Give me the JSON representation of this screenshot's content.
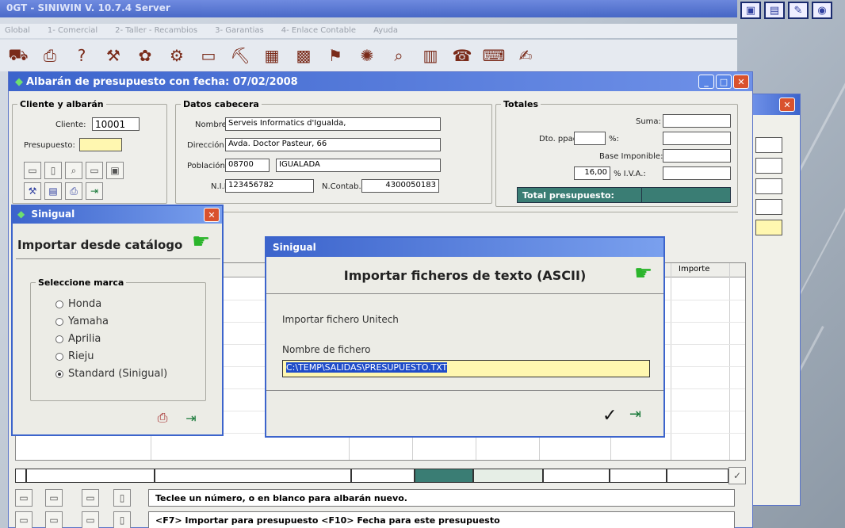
{
  "app": {
    "title": "0GT - SINIWIN V. 10.7.4 Server",
    "menu": [
      "Global",
      "1- Comercial",
      "2- Taller - Recambios",
      "3- Garantias",
      "4- Enlace Contable",
      "Ayuda"
    ],
    "toolbar_icons": [
      "vehicle-icon",
      "printer-icon",
      "help-icon",
      "tools-icon",
      "gift-icon",
      "gears-icon",
      "monitor-icon",
      "tractor-icon",
      "bricks-icon",
      "calendar-icon",
      "flag-icon",
      "sprocket-icon",
      "magnifier-icon",
      "bus-icon",
      "alarm-icon",
      "computer-icon",
      "pen-icon"
    ]
  },
  "main_window": {
    "title": "Albarán de presupuesto con fecha: 07/02/2008",
    "cliente_group": {
      "title": "Cliente y albarán",
      "cliente_label": "Cliente:",
      "cliente_value": "10001",
      "presupuesto_label": "Presupuesto:",
      "presupuesto_value": ""
    },
    "cabecera_group": {
      "title": "Datos cabecera",
      "nombre_label": "Nombre",
      "nombre_value": "Serveis Informatics d'Igualda,",
      "direccion_label": "Dirección",
      "direccion_value": "Avda. Doctor Pasteur, 66",
      "poblacion_label": "Población",
      "cp_value": "08700",
      "poblacion_value": "IGUALADA",
      "nif_label": "N.I.F.",
      "nif_value": "123456782",
      "ncontab_label": "N.Contab.",
      "ncontab_value": "4300050183"
    },
    "totales_group": {
      "title": "Totales",
      "suma_label": "Suma:",
      "dto_label": "Dto. ppago",
      "pct_label": "%:",
      "base_label": "Base Imponible:",
      "iva_value": "16,00",
      "iva_label": "% I.V.A.:",
      "total_label": "Total presupuesto:"
    },
    "grid_header_importe": "Importe",
    "status_line1": "Teclee un número, o en blanco para albarán nuevo.",
    "status_line2": "<F7> Importar para presupuesto    <F10> Fecha para este presupuesto"
  },
  "dialog_catalog": {
    "title": "Sinigual",
    "heading": "Importar desde catálogo",
    "group_title": "Seleccione marca",
    "options": [
      "Honda",
      "Yamaha",
      "Aprilia",
      "Rieju",
      "Standard (Sinigual)"
    ],
    "selected_index": 4
  },
  "dialog_ascii": {
    "title": "Sinigual",
    "heading": "Importar ficheros de texto (ASCII)",
    "subtitle": "Importar fichero Unitech",
    "file_label": "Nombre de fichero",
    "file_value": "C:\\TEMP\\SALIDAS\\PRESUPUESTO.TXT"
  },
  "colors": {
    "title_blue": "#3c64cc",
    "total_teal": "#3a7d74",
    "highlight_yellow": "#fff7b0"
  }
}
